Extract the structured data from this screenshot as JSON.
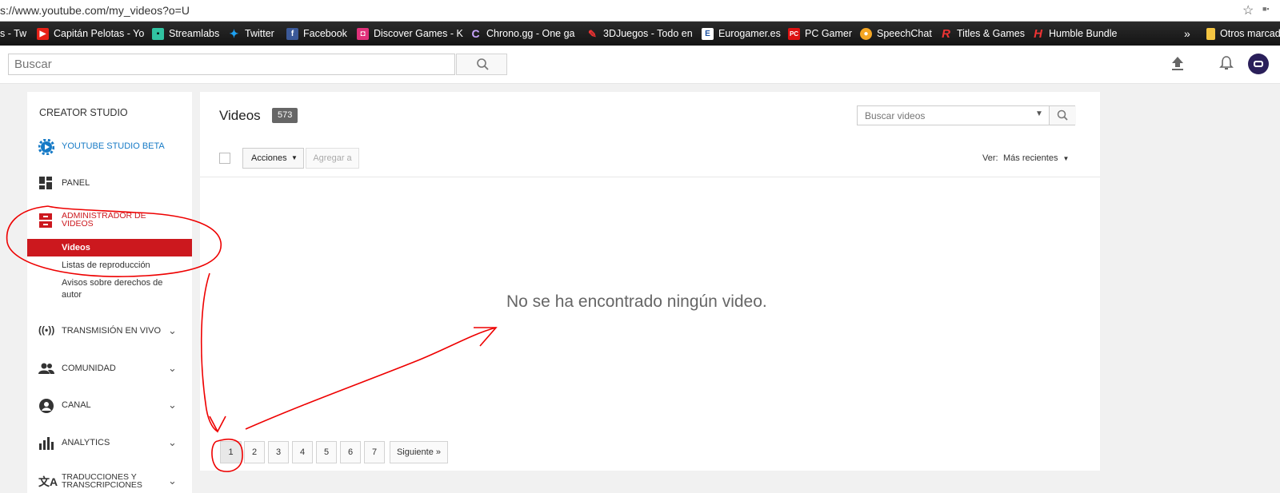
{
  "browser": {
    "url": "s://www.youtube.com/my_videos?o=U",
    "bookmarks": [
      {
        "label": "s - Tw",
        "icon": "twitch-icon"
      },
      {
        "label": "Capitán Pelotas - Yo",
        "icon": "youtube-icon"
      },
      {
        "label": "Streamlabs",
        "icon": "streamlabs-icon"
      },
      {
        "label": "Twitter",
        "icon": "twitter-icon"
      },
      {
        "label": "Facebook",
        "icon": "facebook-icon"
      },
      {
        "label": "Discover Games - K",
        "icon": "discover-icon"
      },
      {
        "label": "Chrono.gg - One ga",
        "icon": "chrono-icon"
      },
      {
        "label": "3DJuegos - Todo en",
        "icon": "3djuegos-icon"
      },
      {
        "label": "Eurogamer.es",
        "icon": "eurogamer-icon"
      },
      {
        "label": "PC Gamer",
        "icon": "pcgamer-icon"
      },
      {
        "label": "SpeechChat",
        "icon": "speechchat-icon"
      },
      {
        "label": "Titles & Games",
        "icon": "titles-icon"
      },
      {
        "label": "Humble Bundle",
        "icon": "humble-icon"
      }
    ],
    "overflow": "»",
    "other_bookmarks": "Otros marcad"
  },
  "masthead": {
    "search_placeholder": "Buscar"
  },
  "sidebar": {
    "header": "CREATOR STUDIO",
    "beta": "YOUTUBE STUDIO BETA",
    "panel": "PANEL",
    "manager": "ADMINISTRADOR DE VIDEOS",
    "manager_items": [
      "Videos",
      "Listas de reproducción",
      "Avisos sobre derechos de autor"
    ],
    "sections": [
      "TRANSMISIÓN EN VIVO",
      "COMUNIDAD",
      "CANAL",
      "ANALYTICS",
      "TRADUCCIONES Y TRANSCRIPCIONES"
    ]
  },
  "main": {
    "title": "Videos",
    "count": "573",
    "search_placeholder": "Buscar videos",
    "actions_label": "Acciones",
    "add_to_label": "Agregar a",
    "view_label": "Ver:",
    "sort_value": "Más recientes",
    "empty_message": "No se ha encontrado ningún video.",
    "pages": [
      "1",
      "2",
      "3",
      "4",
      "5",
      "6",
      "7"
    ],
    "next_label": "Siguiente »"
  },
  "colors": {
    "accent_red": "#cc181e",
    "link_blue": "#167ac6"
  }
}
